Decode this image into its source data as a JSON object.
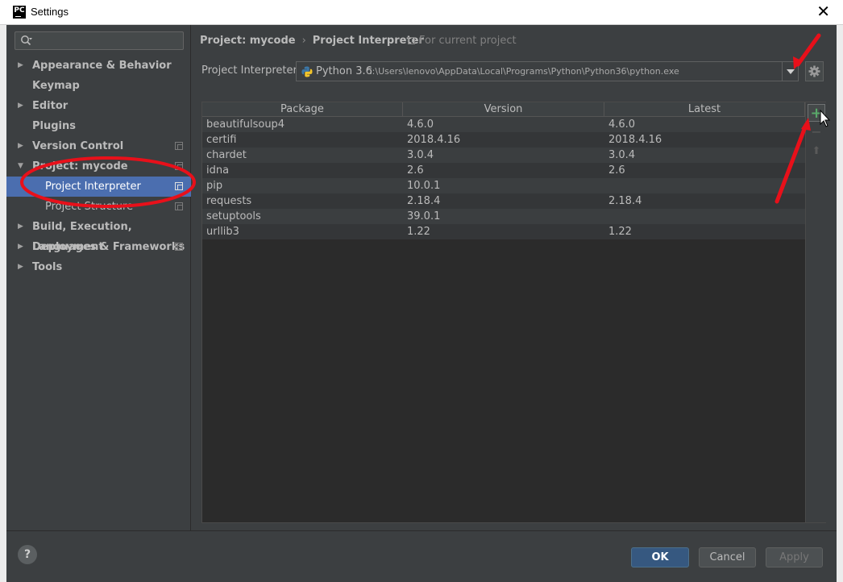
{
  "window": {
    "title": "Settings",
    "app_icon_text": "PC"
  },
  "sidebar": {
    "search_placeholder": "",
    "items": [
      {
        "label": "Appearance & Behavior",
        "expandable": true,
        "bold": true
      },
      {
        "label": "Keymap",
        "expandable": false,
        "bold": true
      },
      {
        "label": "Editor",
        "expandable": true,
        "bold": true
      },
      {
        "label": "Plugins",
        "expandable": false,
        "bold": true
      },
      {
        "label": "Version Control",
        "expandable": true,
        "bold": true,
        "project_icon": true
      },
      {
        "label": "Project: mycode",
        "expandable": true,
        "expanded": true,
        "bold": true,
        "project_icon": true
      },
      {
        "label": "Project Interpreter",
        "child": true,
        "selected": true,
        "project_icon": true
      },
      {
        "label": "Project Structure",
        "child": true,
        "project_icon": true
      },
      {
        "label": "Build, Execution, Deployment",
        "expandable": true,
        "bold": true
      },
      {
        "label": "Languages & Frameworks",
        "expandable": true,
        "bold": true,
        "project_icon": true
      },
      {
        "label": "Tools",
        "expandable": true,
        "bold": true
      }
    ]
  },
  "breadcrumb": {
    "parent": "Project: mycode",
    "separator": "›",
    "current": "Project Interpreter",
    "scope": "For current project"
  },
  "interpreter": {
    "label": "Project Interpreter:",
    "name": "Python 3.6",
    "path": "C:\\Users\\lenovo\\AppData\\Local\\Programs\\Python\\Python36\\python.exe"
  },
  "packages": {
    "columns": [
      "Package",
      "Version",
      "Latest"
    ],
    "rows": [
      [
        "beautifulsoup4",
        "4.6.0",
        "4.6.0"
      ],
      [
        "certifi",
        "2018.4.16",
        "2018.4.16"
      ],
      [
        "chardet",
        "3.0.4",
        "3.0.4"
      ],
      [
        "idna",
        "2.6",
        "2.6"
      ],
      [
        "pip",
        "10.0.1",
        ""
      ],
      [
        "requests",
        "2.18.4",
        "2.18.4"
      ],
      [
        "setuptools",
        "39.0.1",
        ""
      ],
      [
        "urllib3",
        "1.22",
        "1.22"
      ]
    ],
    "tools": {
      "add": "+",
      "remove": "−",
      "up": "⬆"
    }
  },
  "footer": {
    "help": "?",
    "ok": "OK",
    "cancel": "Cancel",
    "apply": "Apply"
  },
  "colors": {
    "accent": "#4b6eaf",
    "annotation": "#e8101a",
    "add_icon": "#59a869"
  }
}
